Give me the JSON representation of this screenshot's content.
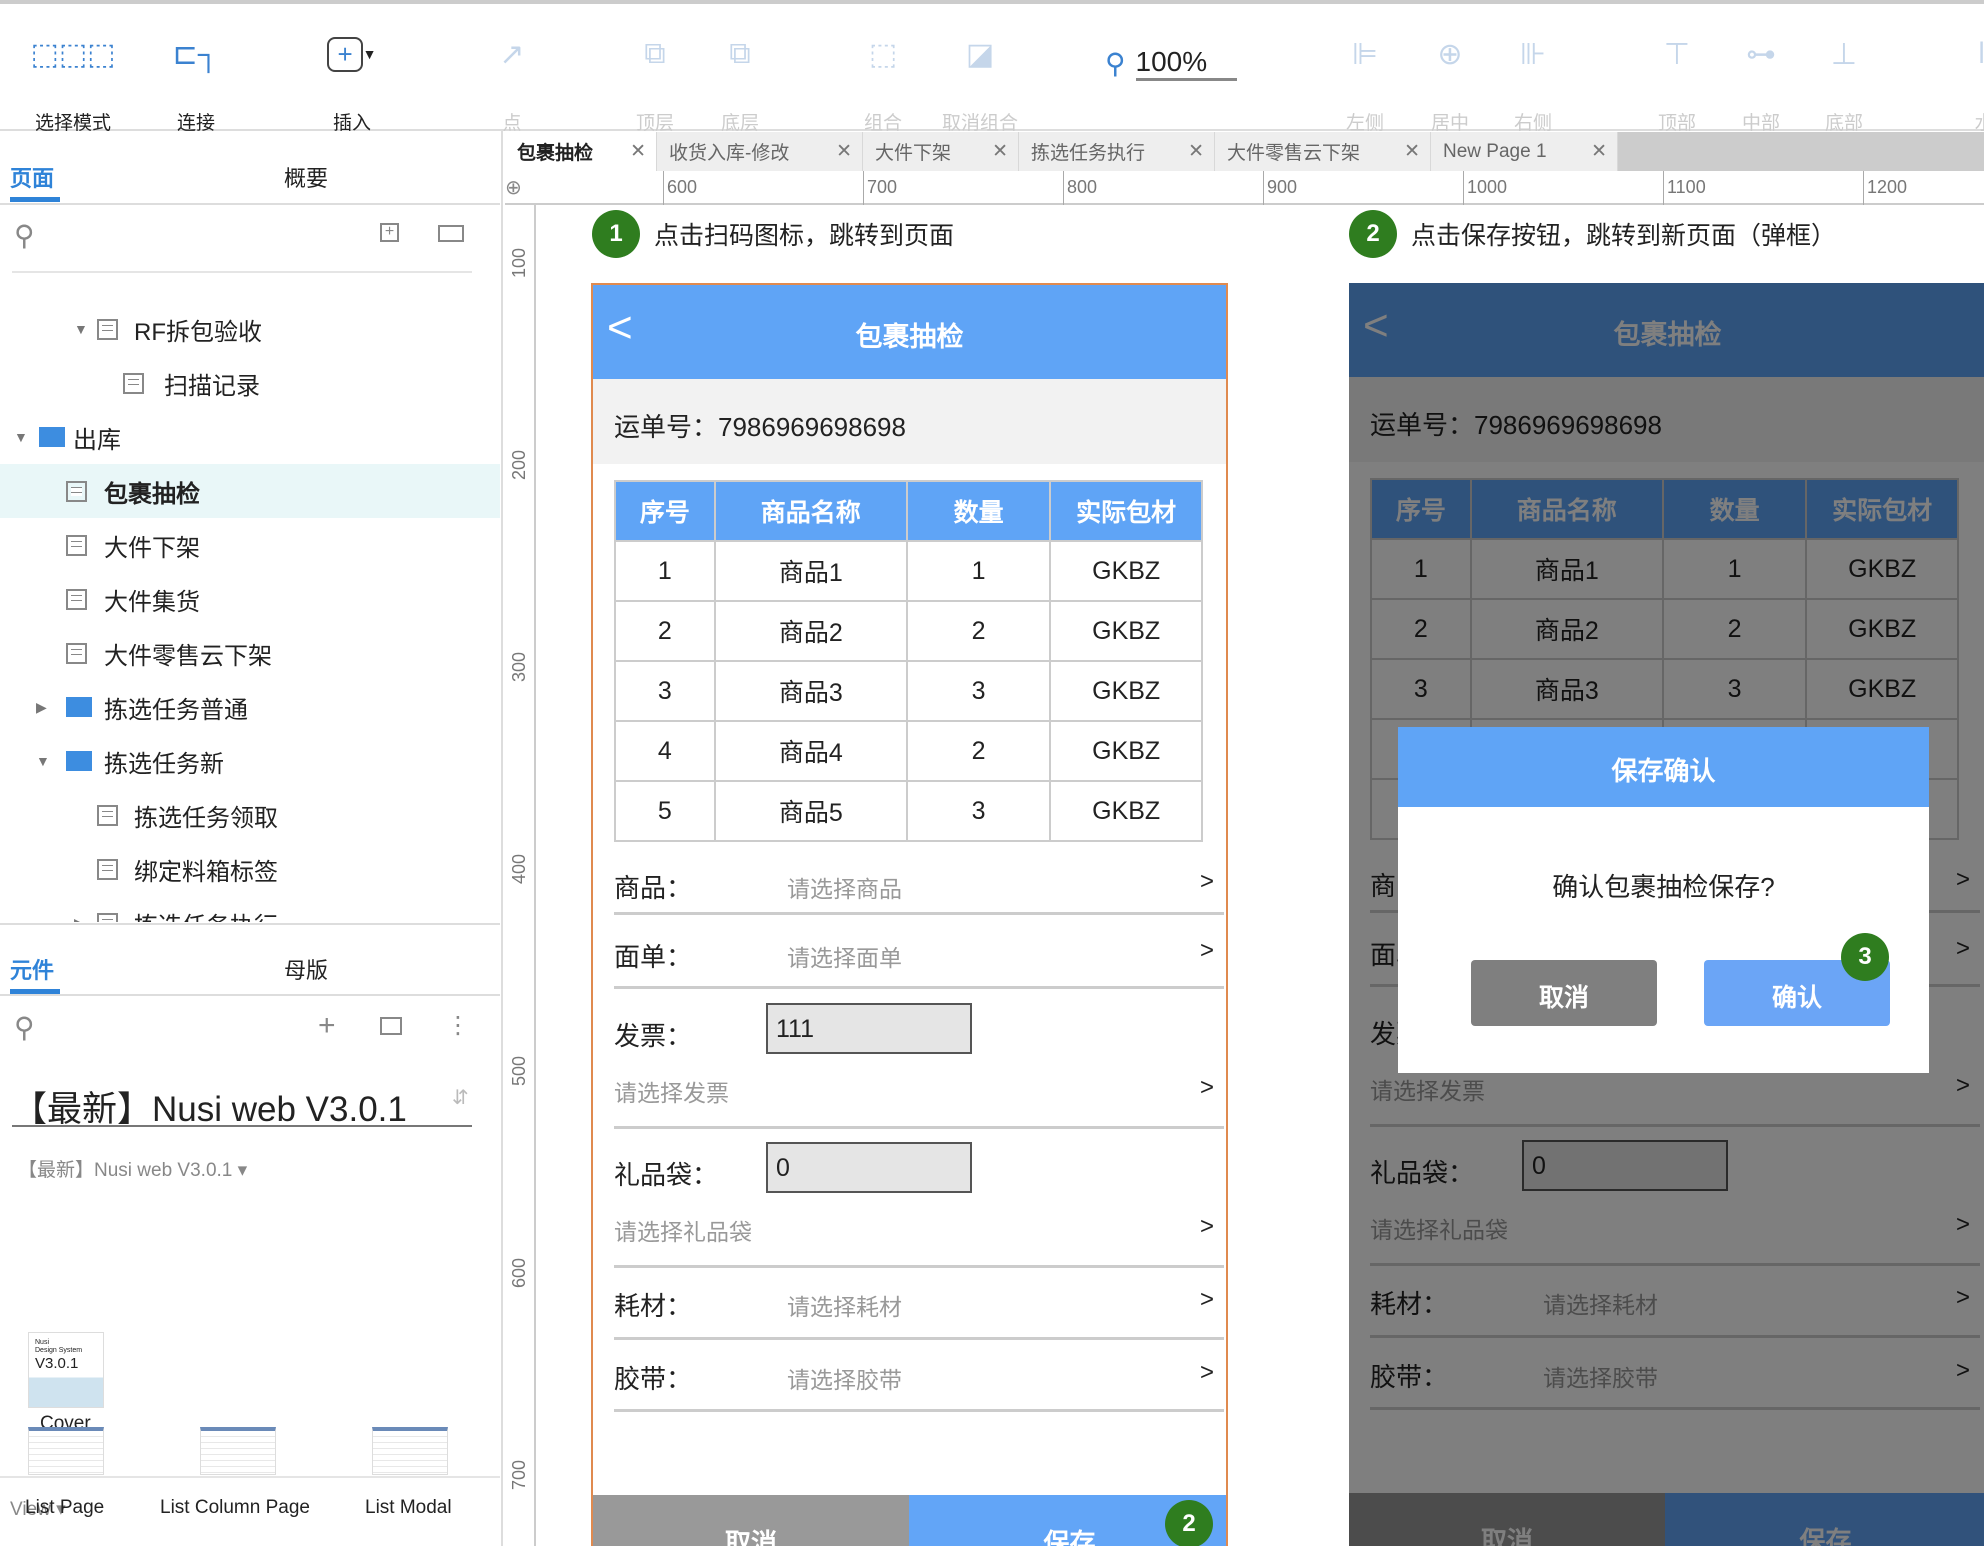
{
  "toolbar": {
    "items": [
      {
        "label": "选择模式",
        "icon": "select-mode-icon",
        "enabled": true
      },
      {
        "label": "连接",
        "icon": "connect-icon",
        "enabled": true
      },
      {
        "label": "插入",
        "icon": "insert-icon",
        "enabled": true
      },
      {
        "label": "点",
        "icon": "point-icon",
        "enabled": false
      },
      {
        "label": "顶层",
        "icon": "bring-front-icon",
        "enabled": false
      },
      {
        "label": "底层",
        "icon": "send-back-icon",
        "enabled": false
      },
      {
        "label": "组合",
        "icon": "group-icon",
        "enabled": false
      },
      {
        "label": "取消组合",
        "icon": "ungroup-icon",
        "enabled": false
      },
      {
        "label": "左侧",
        "icon": "align-left-icon",
        "enabled": false
      },
      {
        "label": "居中",
        "icon": "align-center-icon",
        "enabled": false
      },
      {
        "label": "右侧",
        "icon": "align-right-icon",
        "enabled": false
      },
      {
        "label": "顶部",
        "icon": "align-top-icon",
        "enabled": false
      },
      {
        "label": "中部",
        "icon": "align-middle-icon",
        "enabled": false
      },
      {
        "label": "底部",
        "icon": "align-bottom-icon",
        "enabled": false
      },
      {
        "label": "水",
        "icon": "distribute-icon",
        "enabled": false
      }
    ],
    "zoom": "100%"
  },
  "left": {
    "pages_tab": "页面",
    "outline_tab": "概要",
    "tree": [
      {
        "label": "RF拆包验收",
        "type": "page",
        "level": 2,
        "expand": "open"
      },
      {
        "label": "扫描记录",
        "type": "page",
        "level": 3
      },
      {
        "label": "出库",
        "type": "folder",
        "level": 0,
        "expand": "open"
      },
      {
        "label": "包裹抽检",
        "type": "page",
        "level": 1,
        "selected": true
      },
      {
        "label": "大件下架",
        "type": "page",
        "level": 1
      },
      {
        "label": "大件集货",
        "type": "page",
        "level": 1
      },
      {
        "label": "大件零售云下架",
        "type": "page",
        "level": 1
      },
      {
        "label": "拣选任务普通",
        "type": "folder",
        "level": 1,
        "expand": "closed"
      },
      {
        "label": "拣选任务新",
        "type": "folder",
        "level": 1,
        "expand": "open"
      },
      {
        "label": "拣选任务领取",
        "type": "page",
        "level": 2
      },
      {
        "label": "绑定料箱标签",
        "type": "page",
        "level": 2
      },
      {
        "label": "拣选任务执行",
        "type": "page",
        "level": 2,
        "expand": "closed"
      }
    ],
    "widgets_tab": "元件",
    "masters_tab": "母版",
    "library": "【最新】Nusi web V3.0.1",
    "library_sub": "【最新】Nusi web V3.0.1",
    "cover_thumb": {
      "line1": "Nusi",
      "line2": "Design System",
      "line3": "V3.0.1"
    },
    "cover_label": "Cover",
    "view_label": "View",
    "views": [
      "List Page",
      "List Column Page",
      "List Modal"
    ]
  },
  "tabs": [
    "包裹抽检",
    "收货入库-修改",
    "大件下架",
    "拣选任务执行",
    "大件零售云下架",
    "New Page 1"
  ],
  "ruler": {
    "h": [
      "600",
      "700",
      "800",
      "900",
      "1000",
      "1100",
      "1200"
    ],
    "v": [
      "100",
      "200",
      "300",
      "400",
      "500",
      "600",
      "700"
    ]
  },
  "annotations": [
    {
      "num": "1",
      "text": "点击扫码图标，跳转到页面"
    },
    {
      "num": "2",
      "text": "点击保存按钮，跳转到新页面（弹框）"
    }
  ],
  "phone": {
    "title": "包裹抽检",
    "back": "<",
    "waybill": "运单号：7986969698698",
    "columns": [
      "序号",
      "商品名称",
      "数量",
      "实际包材"
    ],
    "rows": [
      [
        "1",
        "商品1",
        "1",
        "GKBZ"
      ],
      [
        "2",
        "商品2",
        "2",
        "GKBZ"
      ],
      [
        "3",
        "商品3",
        "3",
        "GKBZ"
      ],
      [
        "4",
        "商品4",
        "2",
        "GKBZ"
      ],
      [
        "5",
        "商品5",
        "3",
        "GKBZ"
      ]
    ],
    "fields": {
      "goods": {
        "label": "商品：",
        "placeholder": "请选择商品"
      },
      "sheet": {
        "label": "面单：",
        "placeholder": "请选择面单"
      },
      "invoice": {
        "label": "发票：",
        "value": "111",
        "placeholder": "请选择发票"
      },
      "giftbag": {
        "label": "礼品袋：",
        "value": "0",
        "placeholder": "请选择礼品袋"
      },
      "material": {
        "label": "耗材：",
        "placeholder": "请选择耗材"
      },
      "tape": {
        "label": "胶带：",
        "placeholder": "请选择胶带"
      }
    },
    "chevron": ">",
    "cancel": "取消",
    "save": "保存",
    "save_badge": "2"
  },
  "modal": {
    "title": "保存确认",
    "message": "确认包裹抽检保存?",
    "cancel": "取消",
    "confirm": "确认",
    "badge": "3"
  },
  "colors": {
    "accent": "#5fa4f6",
    "badge": "#2f7d1f",
    "selected_border": "#e08a4f"
  }
}
